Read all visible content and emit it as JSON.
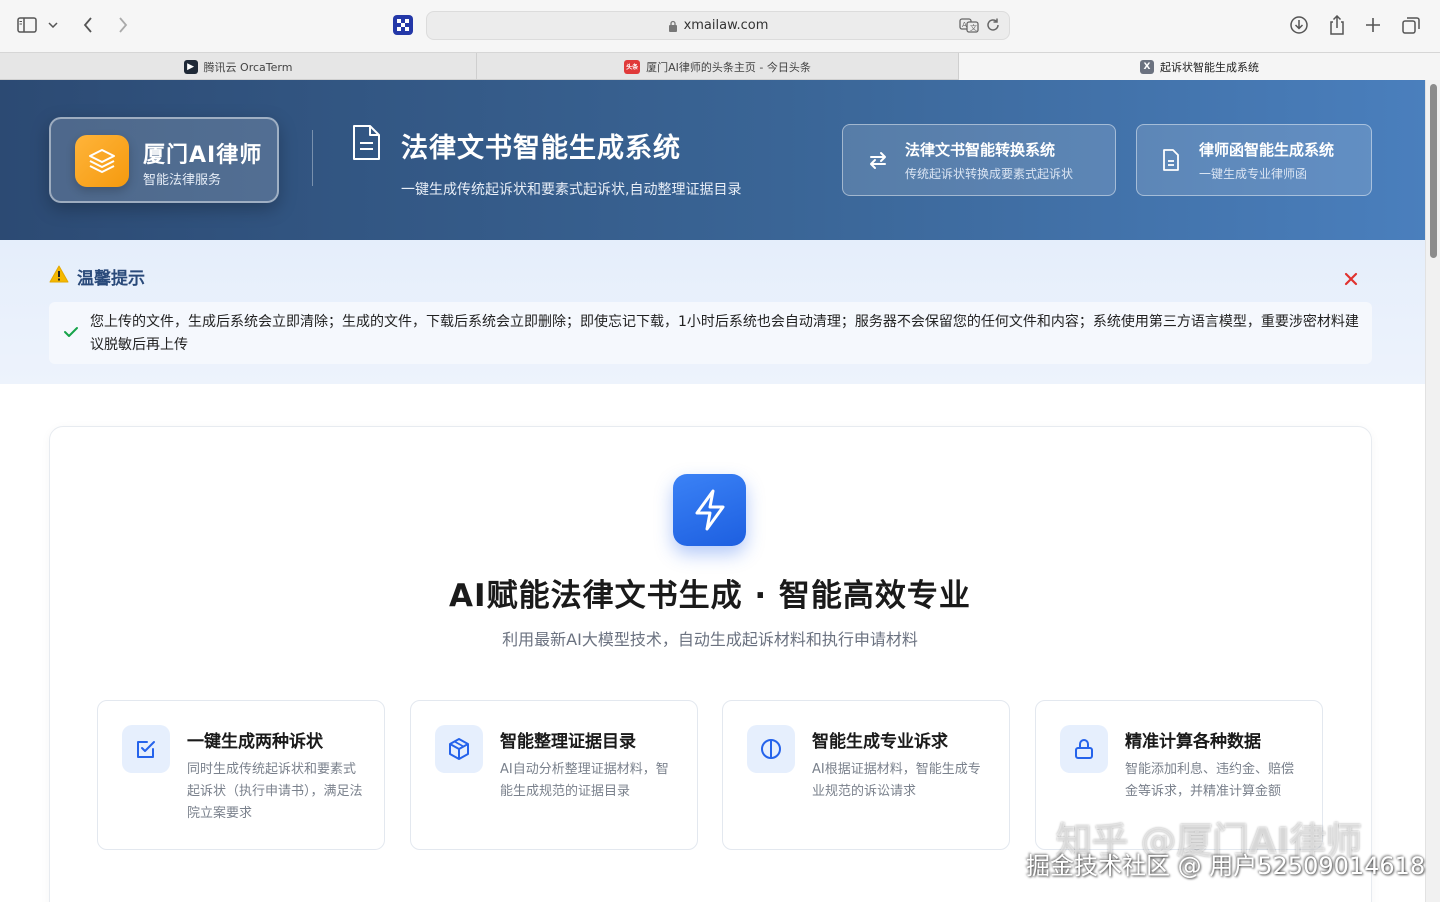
{
  "browser": {
    "url": "xmailaw.com",
    "tabs": [
      {
        "label": "腾讯云 OrcaTerm",
        "fav_color": "#1f2937",
        "fav_glyph": "▶"
      },
      {
        "label": "厦门AI律师的头条主页 - 今日头条",
        "fav_color": "#e03a3a",
        "fav_glyph": "头条"
      },
      {
        "label": "起诉状智能生成系统",
        "fav_color": "#6b7280",
        "fav_glyph": "X"
      }
    ]
  },
  "header": {
    "brand_title": "厦门AI律师",
    "brand_sub": "智能法律服务",
    "title": "法律文书智能生成系统",
    "subtitle": "一键生成传统起诉状和要素式起诉状,自动整理证据目录",
    "cards": [
      {
        "title": "法律文书智能转换系统",
        "sub": "传统起诉状转换成要素式起诉状",
        "icon": "swap-arrows-icon"
      },
      {
        "title": "律师函智能生成系统",
        "sub": "一键生成专业律师函",
        "icon": "document-icon"
      }
    ]
  },
  "notice": {
    "title": "温馨提示",
    "text": "您上传的文件，生成后系统会立即清除；生成的文件，下载后系统会立即删除；即使忘记下载，1小时后系统也会自动清理；服务器不会保留您的任何文件和内容；系统使用第三方语言模型，重要涉密材料建议脱敏后再上传"
  },
  "hero": {
    "title": "AI赋能法律文书生成 · 智能高效专业",
    "subtitle": "利用最新AI大模型技术，自动生成起诉材料和执行申请材料"
  },
  "features": [
    {
      "title": "一键生成两种诉状",
      "desc": "同时生成传统起诉状和要素式起诉状（执行申请书），满足法院立案要求",
      "icon": "checkbox-icon"
    },
    {
      "title": "智能整理证据目录",
      "desc": "AI自动分析整理证据材料，智能生成规范的证据目录",
      "icon": "cube-icon"
    },
    {
      "title": "智能生成专业诉求",
      "desc": "AI根据证据材料，智能生成专业规范的诉讼请求",
      "icon": "circle-half-icon"
    },
    {
      "title": "精准计算各种数据",
      "desc": "智能添加利息、违约金、赔偿金等诉求，并精准计算金额",
      "icon": "lock-icon"
    }
  ],
  "watermark": {
    "line1": "知乎 @厦门AI律师",
    "line2": "掘金技术社区 @ 用户52509014618"
  },
  "colors": {
    "accent": "#2563eb",
    "header_start": "#2c4a73",
    "header_end": "#4a7fbd",
    "brand_orange": "#f59a0e",
    "close_red": "#e0322f"
  }
}
